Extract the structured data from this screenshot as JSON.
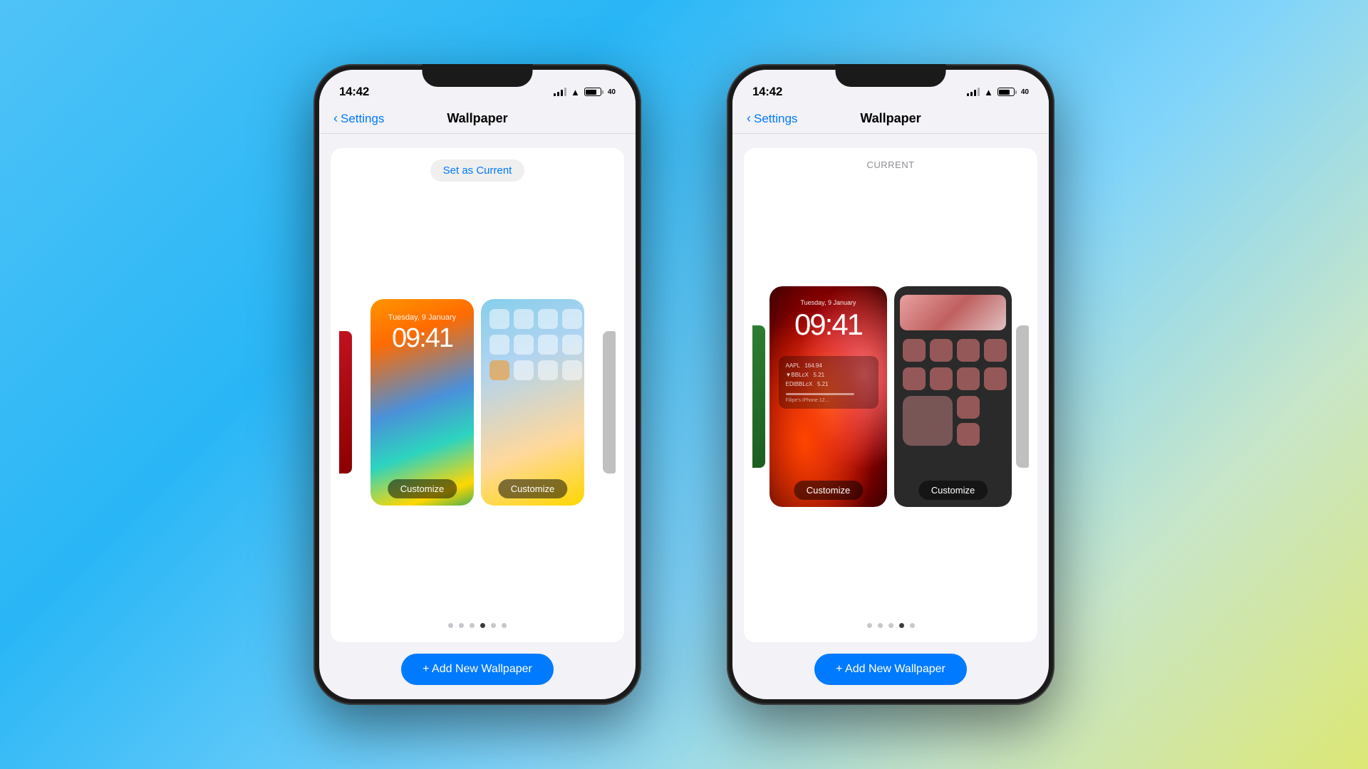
{
  "background": {
    "gradient": "linear-gradient(135deg, #4fc3f7 0%, #29b6f6 30%, #81d4fa 60%, #c8e6c9 80%, #dce775 100%)"
  },
  "phone_left": {
    "status": {
      "time": "14:42",
      "battery_level": "40"
    },
    "nav": {
      "back_label": "Settings",
      "title": "Wallpaper"
    },
    "card": {
      "set_current_label": "Set as Current",
      "add_wallpaper_label": "+ Add New Wallpaper"
    },
    "lock_screen": {
      "date": "Tuesday, 9 January",
      "time": "09:41",
      "customize_label": "Customize"
    },
    "home_screen": {
      "customize_label": "Customize"
    },
    "dots": [
      "",
      "",
      "",
      "active",
      "",
      ""
    ],
    "side_left": "red",
    "side_right": "gray"
  },
  "phone_right": {
    "status": {
      "time": "14:42",
      "battery_level": "40"
    },
    "nav": {
      "back_label": "Settings",
      "title": "Wallpaper"
    },
    "card": {
      "current_label": "CURRENT",
      "add_wallpaper_label": "+ Add New Wallpaper"
    },
    "lock_screen": {
      "date": "Tuesday, 9 January",
      "time": "09:41",
      "customize_label": "Customize"
    },
    "home_screen": {
      "customize_label": "Customize"
    },
    "dots": [
      "",
      "",
      "",
      "active",
      ""
    ],
    "side_left": "green",
    "side_right": "gray"
  }
}
